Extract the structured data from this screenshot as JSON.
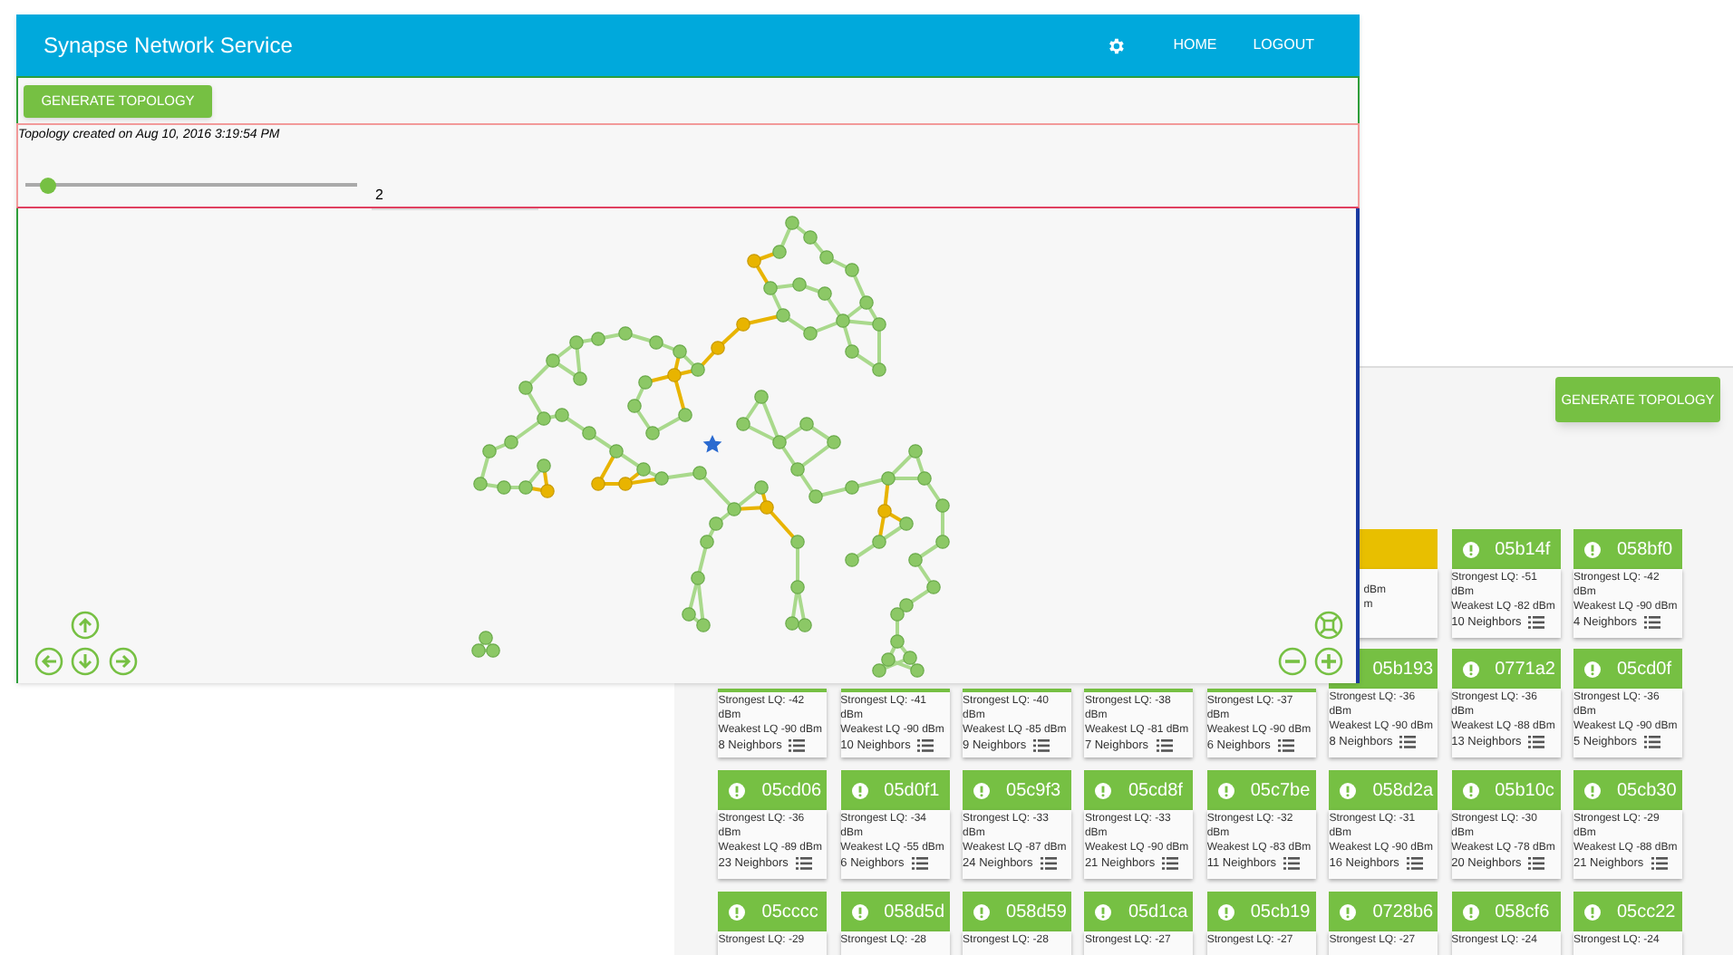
{
  "nodes_window": {
    "generate_button": "GENERATE TOPOLOGY",
    "card_rows": [
      [
        {
          "kind": "clipped",
          "color": "#e8bf00",
          "lines": [
            "dBm",
            "m"
          ]
        },
        {
          "kind": "card",
          "color": "#76c043",
          "id": "05b14f",
          "lines": [
            "Strongest LQ: -51 dBm",
            "Weakest LQ -82 dBm"
          ],
          "neighbors": "10 Neighbors"
        },
        {
          "kind": "card",
          "color": "#76c043",
          "id": "058bf0",
          "lines": [
            "Strongest LQ: -42 dBm",
            "Weakest LQ -90 dBm"
          ],
          "neighbors": "4 Neighbors"
        }
      ],
      [
        {
          "kind": "card",
          "color": "#76c043",
          "lines": [
            "Strongest LQ: -42 dBm",
            "Weakest LQ -90 dBm"
          ],
          "neighbors": "8 Neighbors"
        },
        {
          "kind": "card",
          "color": "#76c043",
          "lines": [
            "Strongest LQ: -41 dBm",
            "Weakest LQ -90 dBm"
          ],
          "neighbors": "10 Neighbors"
        },
        {
          "kind": "card",
          "color": "#76c043",
          "lines": [
            "Strongest LQ: -40 dBm",
            "Weakest LQ -85 dBm"
          ],
          "neighbors": "9 Neighbors"
        },
        {
          "kind": "card",
          "color": "#76c043",
          "lines": [
            "Strongest LQ: -38 dBm",
            "Weakest LQ -81 dBm"
          ],
          "neighbors": "7 Neighbors"
        },
        {
          "kind": "card",
          "color": "#76c043",
          "lines": [
            "Strongest LQ: -37 dBm",
            "Weakest LQ -90 dBm"
          ],
          "neighbors": "6 Neighbors"
        },
        {
          "kind": "covered_icon",
          "color": "#76c043",
          "id": "05b193",
          "lines": [
            "Strongest LQ: -36 dBm",
            "Weakest LQ -90 dBm"
          ],
          "neighbors": "8 Neighbors"
        },
        {
          "kind": "card",
          "color": "#76c043",
          "id": "0771a2",
          "lines": [
            "Strongest LQ: -36 dBm",
            "Weakest LQ -88 dBm"
          ],
          "neighbors": "13 Neighbors"
        },
        {
          "kind": "card",
          "color": "#76c043",
          "id": "05cd0f",
          "lines": [
            "Strongest LQ: -36 dBm",
            "Weakest LQ -90 dBm"
          ],
          "neighbors": "5 Neighbors"
        }
      ],
      [
        {
          "kind": "card",
          "color": "#76c043",
          "id": "05cd06",
          "lines": [
            "Strongest LQ: -36 dBm",
            "Weakest LQ -89 dBm"
          ],
          "neighbors": "23 Neighbors"
        },
        {
          "kind": "card",
          "color": "#76c043",
          "id": "05d0f1",
          "lines": [
            "Strongest LQ: -34 dBm",
            "Weakest LQ -55 dBm"
          ],
          "neighbors": "6 Neighbors"
        },
        {
          "kind": "card",
          "color": "#76c043",
          "id": "05c9f3",
          "lines": [
            "Strongest LQ: -33 dBm",
            "Weakest LQ -87 dBm"
          ],
          "neighbors": "24 Neighbors"
        },
        {
          "kind": "card",
          "color": "#76c043",
          "id": "05cd8f",
          "lines": [
            "Strongest LQ: -33 dBm",
            "Weakest LQ -90 dBm"
          ],
          "neighbors": "21 Neighbors"
        },
        {
          "kind": "card",
          "color": "#76c043",
          "id": "05c7be",
          "lines": [
            "Strongest LQ: -32 dBm",
            "Weakest LQ -83 dBm"
          ],
          "neighbors": "11 Neighbors"
        },
        {
          "kind": "card",
          "color": "#76c043",
          "id": "058d2a",
          "lines": [
            "Strongest LQ: -31 dBm",
            "Weakest LQ -90 dBm"
          ],
          "neighbors": "16 Neighbors"
        },
        {
          "kind": "card",
          "color": "#76c043",
          "id": "05b10c",
          "lines": [
            "Strongest LQ: -30 dBm",
            "Weakest LQ -78 dBm"
          ],
          "neighbors": "20 Neighbors"
        },
        {
          "kind": "card",
          "color": "#76c043",
          "id": "05cb30",
          "lines": [
            "Strongest LQ: -29 dBm",
            "Weakest LQ -88 dBm"
          ],
          "neighbors": "21 Neighbors"
        }
      ],
      [
        {
          "kind": "card",
          "color": "#76c043",
          "id": "05cccc",
          "lines": [
            "Strongest LQ: -29"
          ]
        },
        {
          "kind": "card",
          "color": "#76c043",
          "id": "058d5d",
          "lines": [
            "Strongest LQ: -28"
          ]
        },
        {
          "kind": "card",
          "color": "#76c043",
          "id": "058d59",
          "lines": [
            "Strongest LQ: -28"
          ]
        },
        {
          "kind": "card",
          "color": "#76c043",
          "id": "05d1ca",
          "lines": [
            "Strongest LQ: -27"
          ]
        },
        {
          "kind": "card",
          "color": "#76c043",
          "id": "05cb19",
          "lines": [
            "Strongest LQ: -27"
          ]
        },
        {
          "kind": "card",
          "color": "#76c043",
          "id": "0728b6",
          "lines": [
            "Strongest LQ: -27"
          ]
        },
        {
          "kind": "card",
          "color": "#76c043",
          "id": "058cf6",
          "lines": [
            "Strongest LQ: -24"
          ]
        },
        {
          "kind": "card",
          "color": "#76c043",
          "id": "05cc22",
          "lines": [
            "Strongest LQ: -24"
          ]
        }
      ]
    ]
  },
  "topology_window": {
    "header": {
      "title": "Synapse Network Service",
      "actions": [
        {
          "kind": "settings"
        },
        {
          "kind": "link",
          "label": "HOME"
        },
        {
          "kind": "link",
          "label": "LOGOUT"
        }
      ]
    },
    "generate_button": "GENERATE TOPOLOGY",
    "created_text": "Topology created on Aug 10, 2016 3:19:54 PM",
    "slider": {
      "level": 0.07
    },
    "value_field": {
      "value": "2"
    },
    "graph_controls": [
      {
        "kind": "up"
      },
      {
        "kind": "left"
      },
      {
        "kind": "down"
      },
      {
        "kind": "right"
      },
      {
        "kind": "fit"
      },
      {
        "kind": "zoom_out"
      },
      {
        "kind": "zoom_in"
      }
    ]
  }
}
